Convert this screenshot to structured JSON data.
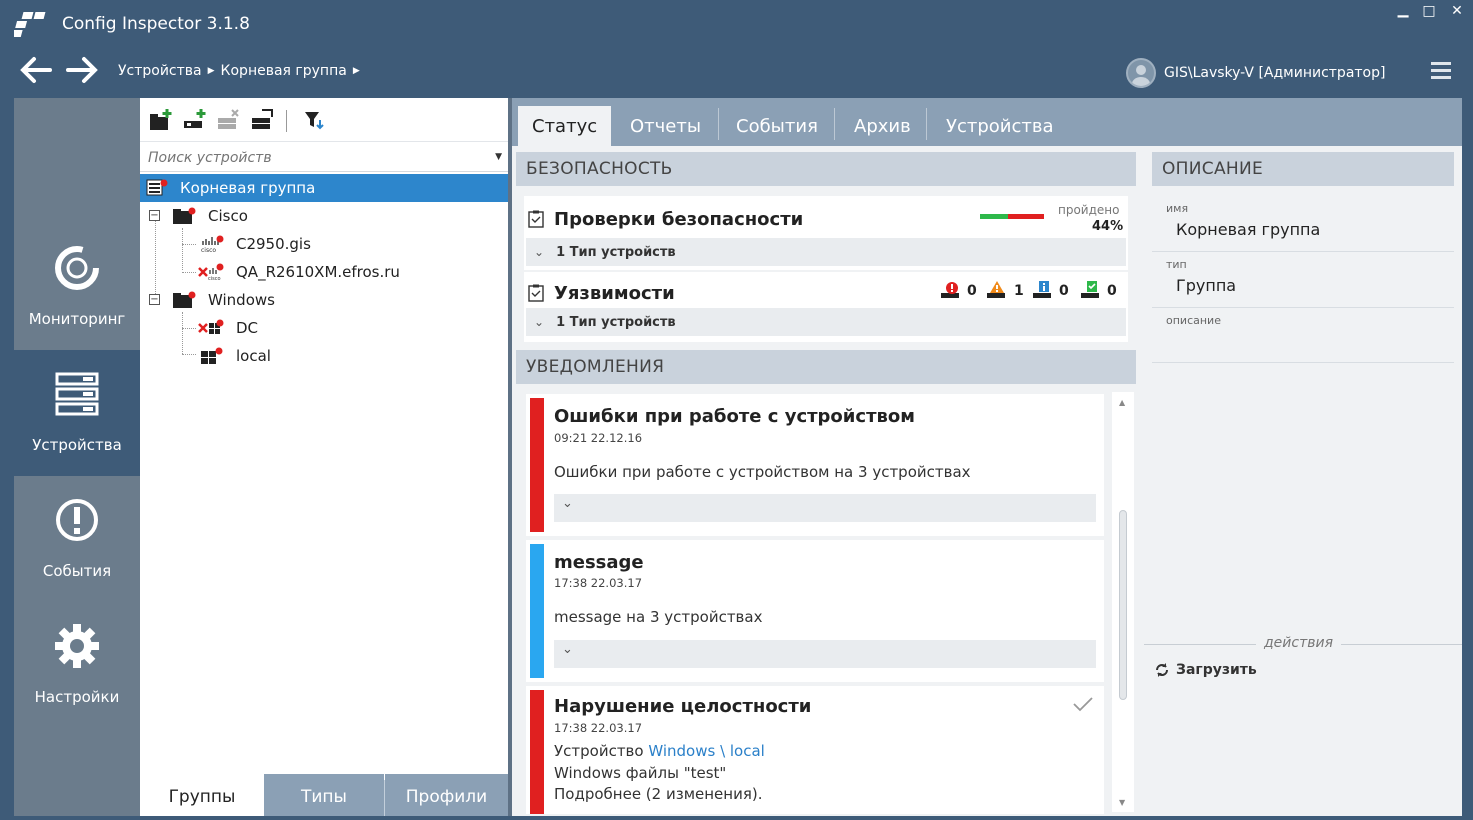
{
  "app": {
    "title": "Config Inspector 3.1.8",
    "window_controls": [
      "minimize",
      "maximize",
      "close"
    ]
  },
  "nav": {
    "breadcrumb": [
      "Устройства",
      "Корневая группа"
    ],
    "user": "GIS\\Lavsky-V [Администратор]"
  },
  "rail": {
    "items": [
      {
        "label": "Мониторинг",
        "icon": "monitoring-icon"
      },
      {
        "label": "Устройства",
        "icon": "devices-icon",
        "active": true
      },
      {
        "label": "События",
        "icon": "events-icon"
      },
      {
        "label": "Настройки",
        "icon": "settings-icon"
      }
    ]
  },
  "tree": {
    "search_placeholder": "Поиск устройств",
    "nodes": [
      {
        "label": "Корневая группа",
        "level": 0,
        "selected": true
      },
      {
        "label": "Cisco",
        "level": 1
      },
      {
        "label": "C2950.gis",
        "level": 2
      },
      {
        "label": "QA_R2610XM.efros.ru",
        "level": 2
      },
      {
        "label": "Windows",
        "level": 1
      },
      {
        "label": "DC",
        "level": 2
      },
      {
        "label": "local",
        "level": 2
      }
    ],
    "bottom_tabs": [
      "Группы",
      "Типы",
      "Профили"
    ]
  },
  "tabs": [
    "Статус",
    "Отчеты",
    "События",
    "Архив",
    "Устройства"
  ],
  "security": {
    "header": "БЕЗОПАСНОСТЬ",
    "checks": {
      "title": "Проверки безопасности",
      "passed_label": "пройдено",
      "passed_value": "44%",
      "passed_fraction": 0.44,
      "device_types": "1 Тип устройств"
    },
    "vulns": {
      "title": "Уязвимости",
      "counts": [
        "0",
        "1",
        "0",
        "0"
      ],
      "device_types": "1 Тип устройств"
    }
  },
  "notifications": {
    "header": "УВЕДОМЛЕНИЯ",
    "items": [
      {
        "title": "Ошибки при работе с устройством",
        "time": "09:21 22.12.16",
        "body": "Ошибки при работе с устройством на 3 устройствах",
        "color": "#e02020"
      },
      {
        "title": "message",
        "time": "17:38 22.03.17",
        "body": "message на 3 устройствах",
        "color": "#2aa7f0"
      },
      {
        "title": "Нарушение целостности",
        "time": "17:38 22.03.17",
        "body_prefix": "Устройство ",
        "body_link": "Windows \\ local",
        "line2": "Windows файлы \"test\"",
        "line3": "Подробнее (2 изменения).",
        "color": "#e02020"
      }
    ]
  },
  "description": {
    "header": "ОПИСАНИЕ",
    "name_label": "имя",
    "name_value": "Корневая группа",
    "type_label": "тип",
    "type_value": "Группа",
    "desc_label": "описание",
    "actions_label": "действия",
    "load_button": "Загрузить"
  }
}
